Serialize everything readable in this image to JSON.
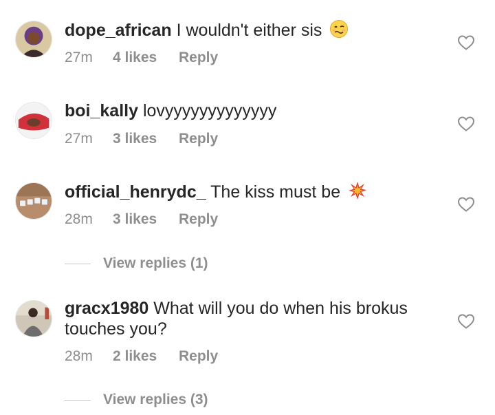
{
  "comments": [
    {
      "username": "dope_african",
      "text": "I wouldn't either sis",
      "emoji": "woozy-face-emoji",
      "time": "27m",
      "likes": "4 likes",
      "reply": "Reply"
    },
    {
      "username": "boi_kally",
      "text": "lovyyyyyyyyyyyyy",
      "time": "27m",
      "likes": "3 likes",
      "reply": "Reply"
    },
    {
      "username": "official_henrydc_",
      "text": "The kiss must be",
      "emoji": "collision-emoji",
      "time": "28m",
      "likes": "3 likes",
      "reply": "Reply",
      "view_replies": "View replies (1)"
    },
    {
      "username": "gracx1980",
      "text": "What will you do when his brokus touches you?",
      "time": "28m",
      "likes": "2 likes",
      "reply": "Reply",
      "view_replies": "View replies (3)"
    }
  ],
  "colors": {
    "text": "#262626",
    "secondary": "#8e8e8e",
    "divider": "#c7c7c7"
  },
  "icons": {
    "like": "heart-outline-icon"
  }
}
